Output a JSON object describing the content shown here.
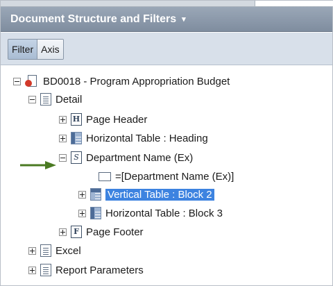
{
  "panel": {
    "title": "Document Structure and Filters",
    "title_caret": "▾"
  },
  "toolbar": {
    "filter_label": "Filter",
    "axis_label": "Axis"
  },
  "tree": {
    "root": "BD0018 - Program Appropriation Budget",
    "detail": "Detail",
    "page_header": "Page Header",
    "horizontal_heading": "Horizontal Table : Heading",
    "department_section": "Department Name (Ex)",
    "department_cell": "=[Department Name (Ex)]",
    "vertical_block2": "Vertical Table : Block 2",
    "horizontal_block3": "Horizontal Table : Block 3",
    "page_footer": "Page Footer",
    "excel": "Excel",
    "report_parameters": "Report Parameters"
  },
  "icons": {
    "header_letter": "H",
    "section_letter": "S",
    "footer_letter": "F"
  },
  "colors": {
    "header_bg": "#8795a8",
    "selection": "#3d83e0",
    "arrow": "#4a7a22"
  }
}
